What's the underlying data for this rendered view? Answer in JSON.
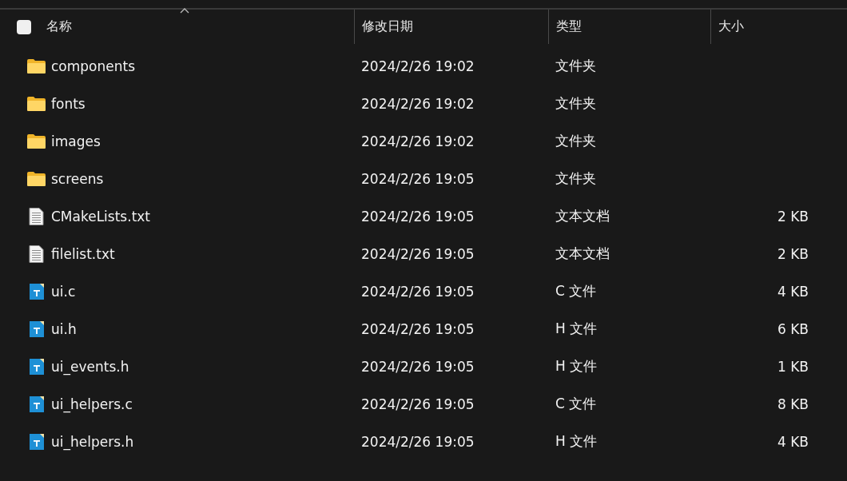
{
  "header": {
    "select_all": {
      "checked": false
    },
    "columns": [
      {
        "label": "名称",
        "sorted": true
      },
      {
        "label": "修改日期",
        "sorted": false
      },
      {
        "label": "类型",
        "sorted": false
      },
      {
        "label": "大小",
        "sorted": false
      }
    ]
  },
  "files": [
    {
      "kind": "folder",
      "name": "components",
      "modified": "2024/2/26 19:02",
      "type": "文件夹"
    },
    {
      "kind": "folder",
      "name": "fonts",
      "modified": "2024/2/26 19:02",
      "type": "文件夹"
    },
    {
      "kind": "folder",
      "name": "images",
      "modified": "2024/2/26 19:02",
      "type": "文件夹"
    },
    {
      "kind": "folder",
      "name": "screens",
      "modified": "2024/2/26 19:05",
      "type": "文件夹"
    },
    {
      "kind": "text",
      "name": "CMakeLists.txt",
      "modified": "2024/2/26 19:05",
      "type": "文本文档",
      "size": "2 KB"
    },
    {
      "kind": "text",
      "name": "filelist.txt",
      "modified": "2024/2/26 19:05",
      "type": "文本文档",
      "size": "2 KB"
    },
    {
      "kind": "code",
      "name": "ui.c",
      "modified": "2024/2/26 19:05",
      "type": "C 文件",
      "size": "4 KB"
    },
    {
      "kind": "code",
      "name": "ui.h",
      "modified": "2024/2/26 19:05",
      "type": "H 文件",
      "size": "6 KB"
    },
    {
      "kind": "code",
      "name": "ui_events.h",
      "modified": "2024/2/26 19:05",
      "type": "H 文件",
      "size": "1 KB"
    },
    {
      "kind": "code",
      "name": "ui_helpers.c",
      "modified": "2024/2/26 19:05",
      "type": "C 文件",
      "size": "8 KB"
    },
    {
      "kind": "code",
      "name": "ui_helpers.h",
      "modified": "2024/2/26 19:05",
      "type": "H 文件",
      "size": "4 KB"
    }
  ]
}
